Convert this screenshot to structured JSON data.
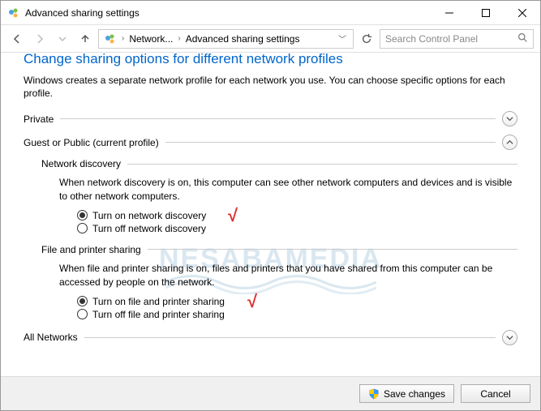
{
  "window": {
    "title": "Advanced sharing settings",
    "min_label": "Minimize",
    "max_label": "Maximize",
    "close_label": "Close"
  },
  "nav": {
    "breadcrumb1": "Network...",
    "breadcrumb2": "Advanced sharing settings",
    "search_placeholder": "Search Control Panel"
  },
  "content": {
    "heading": "Change sharing options for different network profiles",
    "intro": "Windows creates a separate network profile for each network you use. You can choose specific options for each profile.",
    "private_label": "Private",
    "guest_label": "Guest or Public (current profile)",
    "all_networks_label": "All Networks",
    "network_discovery": {
      "title": "Network discovery",
      "desc": "When network discovery is on, this computer can see other network computers and devices and is visible to other network computers.",
      "on": "Turn on network discovery",
      "off": "Turn off network discovery"
    },
    "file_printer": {
      "title": "File and printer sharing",
      "desc": "When file and printer sharing is on, files and printers that you have shared from this computer can be accessed by people on the network.",
      "on": "Turn on file and printer sharing",
      "off": "Turn off file and printer sharing"
    }
  },
  "footer": {
    "save": "Save changes",
    "cancel": "Cancel"
  },
  "watermark": "NESABAMEDIA"
}
